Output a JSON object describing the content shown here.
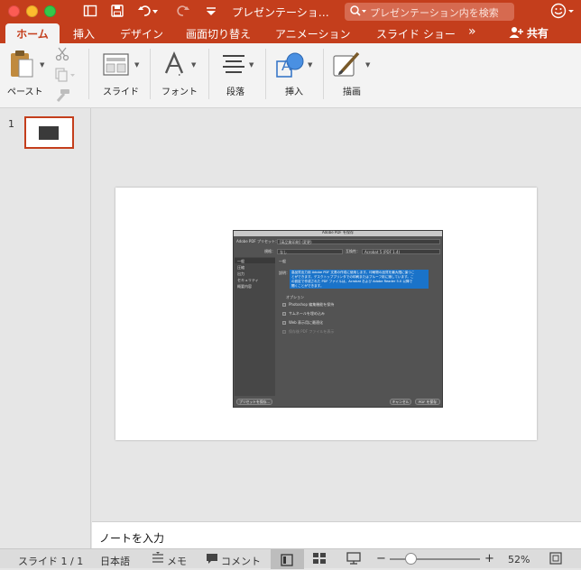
{
  "window": {
    "title": "プレゼンテーショ…",
    "search_placeholder": "プレゼンテーション内を検索"
  },
  "tabs": [
    "ホーム",
    "挿入",
    "デザイン",
    "画面切り替え",
    "アニメーション",
    "スライド ショー"
  ],
  "tabs_more": "»",
  "share_label": "共有",
  "ribbon": {
    "paste": "ペースト",
    "slide": "スライド",
    "font": "フォント",
    "paragraph": "段落",
    "insert": "挿入",
    "draw": "描画"
  },
  "thumbnails": [
    {
      "number": "1"
    }
  ],
  "dialog": {
    "title": "Adobe PDF を保存",
    "preset_label": "Adobe PDF プリセット：",
    "preset_value": "[高品質印刷] (変更)",
    "standard_label": "規格：",
    "standard_value": "なし",
    "compat_label": "互換性：",
    "compat_value": "Acrobat 5 (PDF 1.4)",
    "sidebar": [
      "一般",
      "圧縮",
      "出力",
      "セキュリティ",
      "概要内容"
    ],
    "section": "一般",
    "desc_label": "説明：",
    "desc_lines": [
      "高品質出力用 Adobe PDF 文書の作成に使用します。印刷物の品質を最大限に保つこ",
      "とができます。デスクトッププリンタでの印刷またはプルーフ用に適しています。こ",
      "の設定で作成された PDF ファイルは、Acrobat および Adobe Reader 5.0 以降で",
      "開くことができます。"
    ],
    "options_heading": "オプション",
    "options": [
      "Photoshop 編集機能を保持",
      "サムネールを埋め込み",
      "Web 表示用に最適化",
      "保存後 PDF ファイルを表示"
    ],
    "save_preset": "プリセットを保存...",
    "cancel": "キャンセル",
    "save_pdf": "PDF を保存"
  },
  "notes_placeholder": "ノートを入力",
  "status": {
    "slide_indicator": "スライド 1 / 1",
    "language": "日本語",
    "notes": "メモ",
    "comments": "コメント",
    "zoom_minus": "−",
    "zoom_plus": "+",
    "zoom_percent": "52%",
    "zoom_level": 0.52
  },
  "colors": {
    "accent": "#c43e1c",
    "ribbon_bg": "#f3f3f3",
    "canvas_bg": "#e6e6e6"
  },
  "icons": {
    "close": "close-icon",
    "minimize": "minimize-icon",
    "maximize": "maximize-icon",
    "sidebar": "sidebar-toggle-icon",
    "save": "save-icon",
    "undo": "undo-icon",
    "redo": "redo-icon",
    "customize": "customize-toolbar-icon",
    "search": "search-icon",
    "smiley": "feedback-smiley-icon",
    "share": "share-person-icon"
  }
}
